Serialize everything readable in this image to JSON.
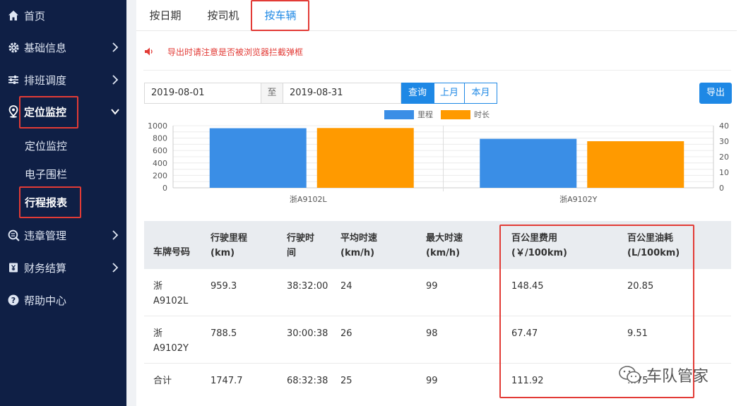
{
  "sidebar": {
    "items": [
      {
        "label": "首页",
        "icon": "home-icon"
      },
      {
        "label": "基础信息",
        "icon": "gear-icon"
      },
      {
        "label": "排班调度",
        "icon": "sliders-icon"
      },
      {
        "label": "定位监控",
        "icon": "location-pin-icon"
      },
      {
        "label": "违章管理",
        "icon": "search-list-icon"
      },
      {
        "label": "财务结算",
        "icon": "finance-book-icon"
      },
      {
        "label": "帮助中心",
        "icon": "question-circle-icon"
      }
    ],
    "sub_items": [
      {
        "label": "定位监控"
      },
      {
        "label": "电子围栏"
      },
      {
        "label": "行程报表"
      }
    ]
  },
  "tabs": [
    {
      "label": "按日期"
    },
    {
      "label": "按司机"
    },
    {
      "label": "按车辆"
    }
  ],
  "notice": "导出时请注意是否被浏览器拦截弹框",
  "filter": {
    "start_date": "2019-08-01",
    "to_label": "至",
    "end_date": "2019-08-31",
    "query_label": "查询",
    "last_month_label": "上月",
    "this_month_label": "本月",
    "export_label": "导出"
  },
  "chart_data": {
    "type": "bar",
    "categories": [
      "浙A9102L",
      "浙A9102Y"
    ],
    "series": [
      {
        "name": "里程",
        "axis": "left",
        "color": "#3a8ee6",
        "values": [
          959.3,
          788.5
        ]
      },
      {
        "name": "时长",
        "axis": "right",
        "color": "#ff9a00",
        "values": [
          38.5,
          30.0
        ]
      }
    ],
    "left_axis": {
      "ticks": [
        "0",
        "200",
        "400",
        "600",
        "800",
        "1000"
      ],
      "ylim": [
        0,
        1000
      ]
    },
    "right_axis": {
      "ticks": [
        "0",
        "10",
        "20",
        "30",
        "40"
      ],
      "ylim": [
        0,
        40
      ]
    },
    "legend_position": "top-center",
    "grid": true
  },
  "table": {
    "headers": [
      "车牌号码",
      "行驶里程 (km)",
      "行驶时间",
      "平均时速 (km/h)",
      "最大时速 (km/h)",
      "百公里费用 (￥/100km)",
      "百公里油耗 (L/100km)"
    ],
    "rows": [
      {
        "plate": "浙A9102L",
        "distance": "959.3",
        "time": "38:32:00",
        "avg_speed": "24",
        "max_speed": "99",
        "cost": "148.45",
        "fuel": "20.85"
      },
      {
        "plate": "浙A9102Y",
        "distance": "788.5",
        "time": "30:00:38",
        "avg_speed": "26",
        "max_speed": "98",
        "cost": "67.47",
        "fuel": "9.51"
      },
      {
        "plate": "合计",
        "distance": "1747.7",
        "time": "68:32:38",
        "avg_speed": "25",
        "max_speed": "99",
        "cost": "111.92",
        "fuel": "…75"
      }
    ]
  },
  "watermark": "车队管家",
  "colors": {
    "sidebar_bg": "#0f1f45",
    "accent": "#1e88e5",
    "highlight": "#e23b36"
  }
}
